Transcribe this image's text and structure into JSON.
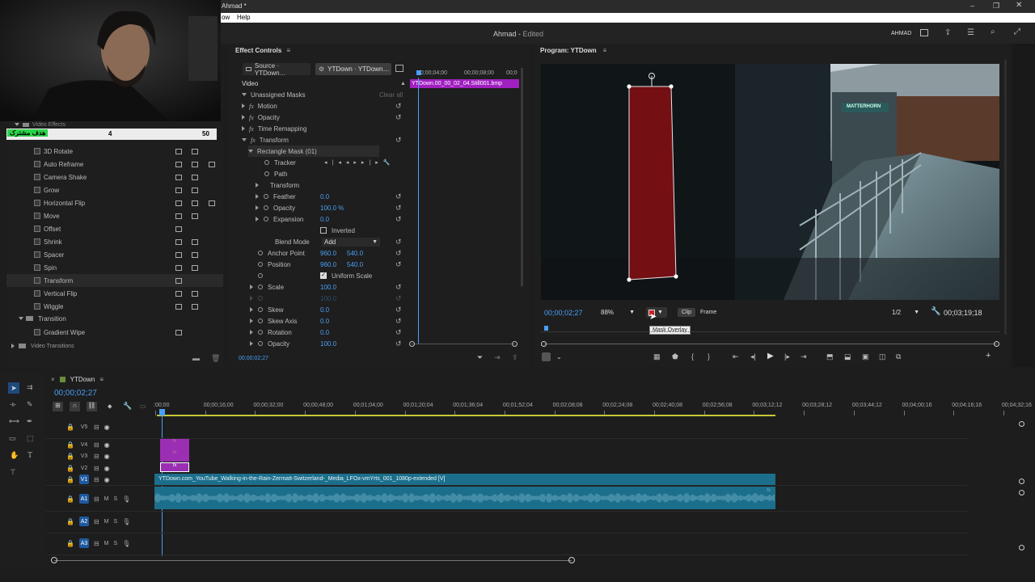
{
  "titlebar": {
    "title": "Ahmad *"
  },
  "menu": {
    "items": [
      "ow",
      "Help"
    ]
  },
  "header": {
    "project": "Ahmad",
    "sep": " - ",
    "status": "Edited",
    "user": "AHMAD"
  },
  "webcam": {
    "overlay_label": "هدف مشترک",
    "count_a": "4",
    "count_b": "50"
  },
  "effects_list": {
    "section_top": "Video Effects",
    "items": [
      "3D Rotate",
      "Auto Reframe",
      "Camera Shake",
      "Grow",
      "Horizontal Flip",
      "Move",
      "Offset",
      "Shrink",
      "Spacer",
      "Spin",
      "Transform",
      "Vertical Flip",
      "Wiggle"
    ],
    "folder_transition": "Transition",
    "transition_items": [
      "Gradient Wipe"
    ],
    "section_bottom": "Video Transitions"
  },
  "effect_controls": {
    "panel_title": "Effect Controls",
    "tab_source": "Source · YTDown…",
    "tab_seq": "YTDown · YTDown…",
    "video_label": "Video",
    "unassigned_masks": "Unassigned Masks",
    "clear_all": "Clear all",
    "motion": "Motion",
    "opacity": "Opacity",
    "time_remap": "Time Remapping",
    "transform": "Transform",
    "mask_name": "Rectangle Mask (01)",
    "tracker": "Tracker",
    "path": "Path",
    "mask_transform": "Transform",
    "feather": "Feather",
    "feather_val": "0.0",
    "mask_opacity": "Opacity",
    "mask_opacity_val": "100.0 %",
    "expansion": "Expansion",
    "expansion_val": "0.0",
    "inverted": "Inverted",
    "blend_mode": "Blend Mode",
    "blend_val": "Add",
    "anchor": "Anchor Point",
    "anchor_x": "960.0",
    "anchor_y": "540.0",
    "position": "Position",
    "position_x": "960.0",
    "position_y": "540.0",
    "uniform_scale": "Uniform Scale",
    "scale": "Scale",
    "scale_val": "100.0",
    "scale_w": "100.0",
    "skew": "Skew",
    "skew_val": "0.0",
    "skew_axis": "Skew Axis",
    "skew_axis_val": "0.0",
    "rotation": "Rotation",
    "rotation_val": "0.0",
    "opacity2": "Opacity",
    "opacity2_val": "100.0",
    "timecode": "00;00;02;27",
    "ruler": [
      "00;00;04;00",
      "00;00;08;00",
      "00;0"
    ],
    "clip_name": "YTDown.00_00_02_04.Still001.bmp"
  },
  "program": {
    "title": "Program: YTDown",
    "timecode": "00;00;02;27",
    "zoom": "88%",
    "tooltip": "Mask Overlay",
    "btn_clip": "Clip",
    "btn_frame": "Frame",
    "resolution": "1/2",
    "duration": "00;03;19;18",
    "sign_text": "MATTERHORN"
  },
  "timeline": {
    "seq_name": "YTDown",
    "timecode": "00;00;02;27",
    "ruler": [
      ":00;00",
      "00;00;16;00",
      "00;00;32;00",
      "00;00;48;00",
      "00;01;04;00",
      "00;01;20;04",
      "00;01;36;04",
      "00;01;52;04",
      "00;02;08;08",
      "00;02;24;08",
      "00;02;40;08",
      "00;02;56;08",
      "00;03;12;12",
      "00;03;28;12",
      "00;03;44;12",
      "00;04;00;16",
      "00;04;16;16",
      "00;04;32;16"
    ],
    "tracks_video": [
      "V5",
      "V4",
      "V3",
      "V2",
      "V1"
    ],
    "tracks_audio": [
      "A1",
      "A2",
      "A3"
    ],
    "clip_label": "YTDown.com_YouTube_Walking-in-the-Rain-Zermatt-Switzerland-_Media_LFOx-vmYrts_001_1080p-extended [V]",
    "fx": "fx",
    "m": "M",
    "s": "S"
  },
  "colors": {
    "accent": "#4a9ff5",
    "clip_video": "#1c6f8c",
    "clip_purple": "#9b2fb3",
    "mask_fill": "#7a0f14"
  }
}
